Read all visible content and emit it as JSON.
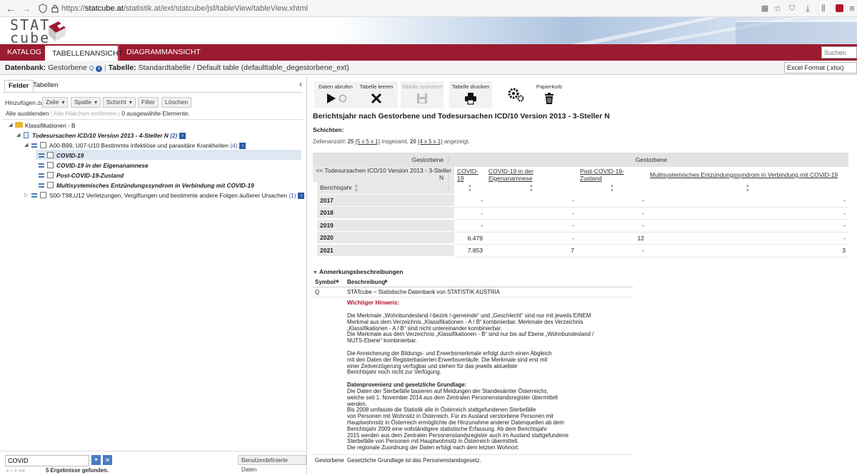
{
  "browser": {
    "url_prefix": "https://",
    "url_host": "statcube.at",
    "url_path": "/statistik.at/ext/statcube/jsf/tableView/tableView.xhtml"
  },
  "logo": {
    "line1": "STAT",
    "line2": "cube"
  },
  "nav": {
    "tabs": [
      {
        "label": "KATALOG"
      },
      {
        "label": "TABELLENANSICHT"
      },
      {
        "label": "DIAGRAMMANSICHT"
      }
    ],
    "search_placeholder": "Suchen"
  },
  "dbrow": {
    "datenbank_label": "Datenbank:",
    "datenbank_value": "Gestorbene",
    "q": "Q",
    "tabelle_label": "Tabelle:",
    "tabelle_value": "Standardtabelle / Default table (defaulttable_degestorbene_ext)",
    "export_format": "Excel Format (.xlsx)"
  },
  "left": {
    "tabs": [
      "Felder",
      "Tabellen"
    ],
    "add_label": "Hinzufügen zu:",
    "add_buttons": [
      "Zeile",
      "Spalte",
      "Schicht"
    ],
    "filter_label": "Filter",
    "delete_label": "Löschen",
    "hide_all": "Alle ausblenden",
    "remove_checks": "Alle Häkchen entfernen",
    "selected_count": "0 ausgewählte Elemente.",
    "tree": {
      "root": "Klassifikationen - B",
      "level1": {
        "label": "Todesursachen ICD/10 Version 2013 - 4-Steller N",
        "count": "(2)"
      },
      "group1": {
        "label": "A00-B99, U07-U10 Bestimmte infektiöse und parasitäre Krankheiten",
        "count": "(4)"
      },
      "items": [
        "COVID-19",
        "COVID-19 in der Eigenanamnese",
        "Post-COVID-19-Zustand",
        "Multisystemisches Entzündungssyndrom in Verbindung mit COVID-19"
      ],
      "group2": {
        "label": "S00-T98,U12 Verletzungen, Vergiftungen und bestimmte andere Folgen äußerer Ursachen",
        "count": "(1)"
      }
    },
    "search_value": "COVID",
    "custom_data": "Benutzerdefinierte Daten",
    "pager": "«  ‹  »  »»",
    "results": "5 Ergebnisse gefunden."
  },
  "toolbar": {
    "fetch": "Daten abrufen",
    "clear": "Tabelle leeren",
    "save": "Tabelle speichern",
    "print": "Tabelle drucken",
    "trash": "Papierkorb"
  },
  "report": {
    "title": "Berichtsjahr nach Gestorbene und Todesursachen ICD/10 Version 2013 - 3-Steller N",
    "layers": "Schichten:",
    "cells_prefix": "Zellenanzahl:",
    "cells_count": "25",
    "cells_dims": "(5 x 5 x 1)",
    "cells_middle": "insgesamt,",
    "cells_shown": "20",
    "cells_dims2": "(4 x 5 x 1)",
    "cells_suffix": "angezeigt."
  },
  "table": {
    "measure_label": "Gestorbene",
    "measure_header": "Gestorbene",
    "column_dim": "<< Todesursachen ICD/10 Version 2013 - 3-Steller N",
    "columns": [
      "COVID-19",
      "COVID-19 in der Eigenanamnese",
      "Post-COVID-19-Zustand",
      "Multisystemisches Entzündungssyndrom in Verbindung mit COVID-19"
    ],
    "row_dim": "Berichtsjahr",
    "rows": [
      {
        "year": "2017",
        "values": [
          "-",
          "-",
          "-",
          "-"
        ]
      },
      {
        "year": "2018",
        "values": [
          "-",
          "-",
          "-",
          "-"
        ]
      },
      {
        "year": "2019",
        "values": [
          "-",
          "-",
          "-",
          "-"
        ]
      },
      {
        "year": "2020",
        "values": [
          "6.479",
          "-",
          "12",
          "-"
        ]
      },
      {
        "year": "2021",
        "values": [
          "7.853",
          "7",
          "-",
          "3"
        ]
      }
    ]
  },
  "notes": {
    "heading": "Anmerkungsbeschreibungen",
    "col_symbol": "Symbol",
    "col_desc": "Beschreibung",
    "q_symbol": "Q",
    "q_desc": "STATcube – Statistische Datenbank von STATISTIK AUSTRIA",
    "warning": "Wichtiger Hinweis:",
    "p1": [
      "Die Merkmale „Wohnbundesland /-bezirk /-gemeinde“ und „Geschlecht“ sind nur mit jeweils EINEM",
      "Merkmal aus dem Verzeichnis „Klassifikationen - A / B“ kombinierbar. Merkmale des Verzeichnis",
      "„Klassifikationen - A / B“ sind nicht untereinander kombinierbar.",
      "Die Merkmale aus dem Verzeichnis „Klassifikationen - B“ sind nur bis auf Ebene „Wohnbundesland /",
      "NUTS-Ebene“ kombinierbar."
    ],
    "p2": [
      "Die Anreicherung der Bildungs- und Erwerbsmerkmale erfolgt durch einen Abgleich",
      "mit den Daten der Registerbasierten Erwerbsverläufe. Die Merkmale sind erst mit",
      "einer Zeitverzögerung verfügbar und stehen für das jeweils aktuellste",
      "Berichtsjahr noch nicht zur Verfügung."
    ],
    "p3_title": "Datenprovenienz und gesetzliche Grundlage:",
    "p3": [
      "Die Daten der Sterbefälle basieren auf Meldungen der Standesämter Österreichs,",
      "welche seit 1. November 2014 aus dem Zentralen Personenstandsregister übermittelt",
      "werden.",
      "Bis 2008 umfasste die Statistik alle in Österreich stattgefundenen Sterbefälle",
      "von Personen mit Wohnsitz in Österreich. Für im Ausland verstorbene Personen mit",
      "Hauptwohnsitz in Österreich ermöglichte die Hinzunahme anderer Datenquellen ab dem",
      "Berichtsjahr 2009 eine vollständigere statistische Erfassung. Ab dem Berichtsjahr",
      "2015 werden aus dem Zentralen Personenstandsregister auch im Ausland stattgefundene",
      "Sterbefälle von Personen mit Hauptwohnsitz in Österreich übermittelt.",
      "Die regionale Zuordnung der Daten erfolgt nach dem letzten Wohnort."
    ],
    "g_symbol": "Gestorbene",
    "g_desc": "Gesetzliche Grundlage ist das Personenstandsgesetz."
  },
  "colors": {
    "accent": "#9b1b30",
    "link_blue": "#2c5aa8",
    "warning_red": "#b0172a"
  }
}
